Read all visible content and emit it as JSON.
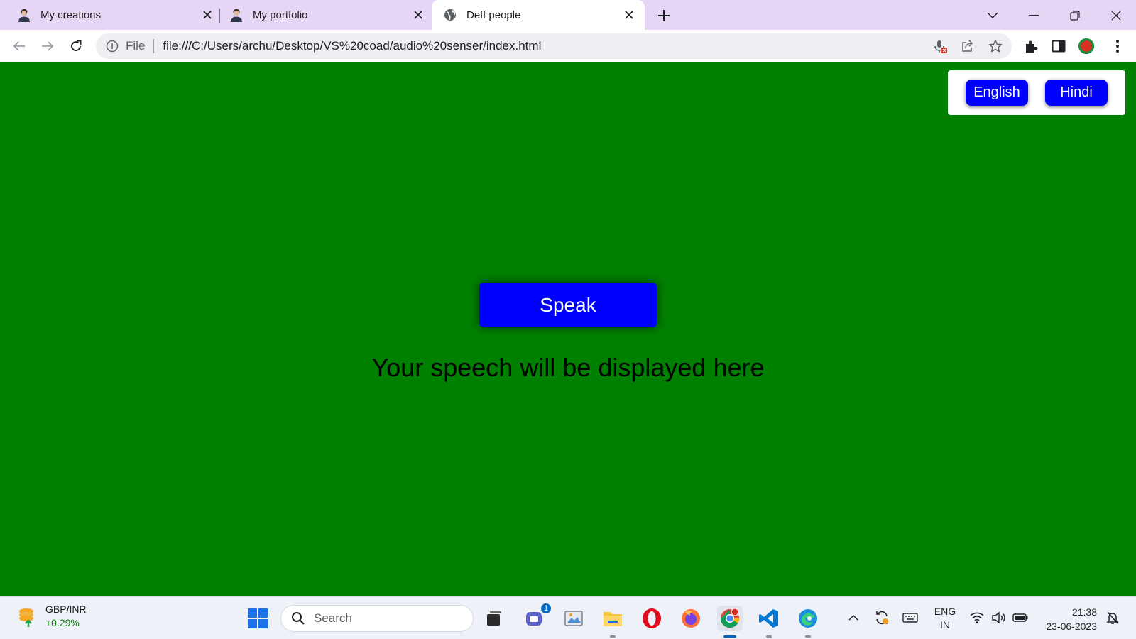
{
  "browser": {
    "tabs": [
      {
        "title": "My creations",
        "favicon": "avatar-icon",
        "active": false
      },
      {
        "title": "My portfolio",
        "favicon": "avatar-icon",
        "active": false
      },
      {
        "title": "Deff people",
        "favicon": "globe-icon",
        "active": true
      }
    ],
    "address": {
      "scheme_label": "File",
      "url": "file:///C:/Users/archu/Desktop/VS%20coad/audio%20senser/index.html"
    }
  },
  "page": {
    "background_color": "#008000",
    "button_color": "#0000ff",
    "language_buttons": [
      "English",
      "Hindi"
    ],
    "speak_label": "Speak",
    "speech_placeholder": "Your speech will be displayed here"
  },
  "taskbar": {
    "widget": {
      "pair": "GBP/INR",
      "change": "+0.29%"
    },
    "search_placeholder": "Search",
    "chat_badge": "1",
    "language": {
      "line1": "ENG",
      "line2": "IN"
    },
    "time": "21:38",
    "date": "23-06-2023"
  }
}
